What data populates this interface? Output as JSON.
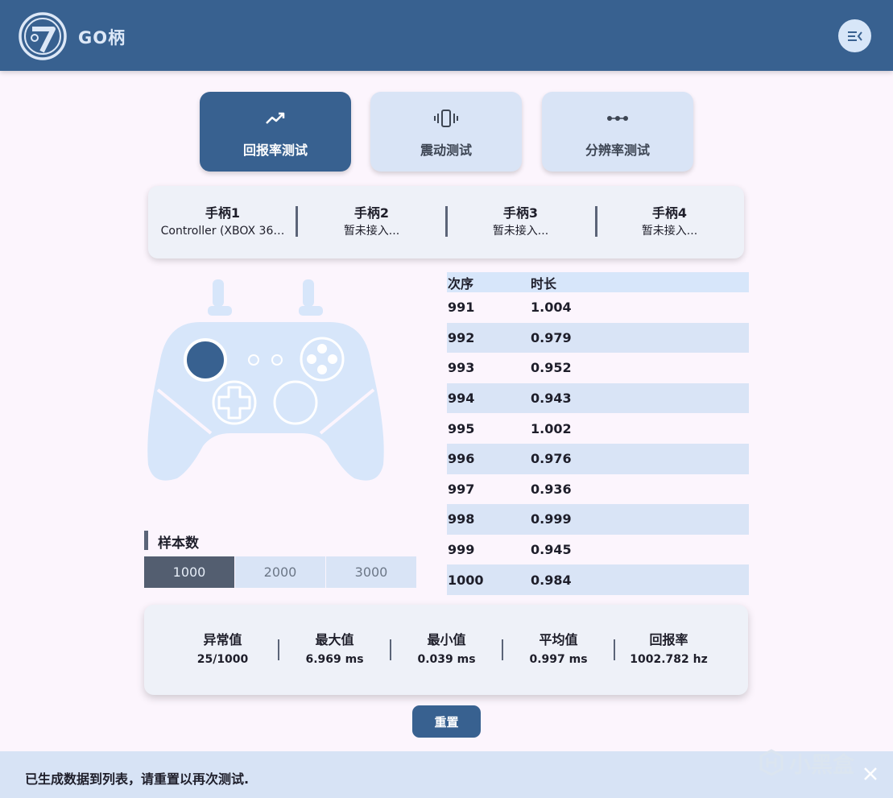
{
  "app": {
    "title": "GO柄",
    "logo_icon": "go-logo-icon",
    "menu_icon": "collapse-menu-icon"
  },
  "colors": {
    "primary": "#386190",
    "light": "#d9e4f6",
    "background": "#fcf5fd",
    "dark": "#535e70"
  },
  "tabs": [
    {
      "label": "回报率测试",
      "icon": "trend-up-icon",
      "active": true
    },
    {
      "label": "震动测试",
      "icon": "vibrate-icon",
      "active": false
    },
    {
      "label": "分辨率测试",
      "icon": "dots-icon",
      "active": false
    }
  ],
  "slots": [
    {
      "name": "手柄1",
      "status": "Controller (XBOX 36…"
    },
    {
      "name": "手柄2",
      "status": "暂未接入..."
    },
    {
      "name": "手柄3",
      "status": "暂未接入..."
    },
    {
      "name": "手柄4",
      "status": "暂未接入..."
    }
  ],
  "sample": {
    "title": "样本数",
    "options": [
      "1000",
      "2000",
      "3000"
    ],
    "selected": "1000"
  },
  "table": {
    "headers": [
      "次序",
      "时长"
    ],
    "rows": [
      [
        "991",
        "1.004"
      ],
      [
        "992",
        "0.979"
      ],
      [
        "993",
        "0.952"
      ],
      [
        "994",
        "0.943"
      ],
      [
        "995",
        "1.002"
      ],
      [
        "996",
        "0.976"
      ],
      [
        "997",
        "0.936"
      ],
      [
        "998",
        "0.999"
      ],
      [
        "999",
        "0.945"
      ],
      [
        "1000",
        "0.984"
      ]
    ]
  },
  "stats": [
    {
      "label": "异常值",
      "value": "25/1000"
    },
    {
      "label": "最大值",
      "value": "6.969 ms"
    },
    {
      "label": "最小值",
      "value": "0.039 ms"
    },
    {
      "label": "平均值",
      "value": "0.997 ms"
    },
    {
      "label": "回报率",
      "value": "1002.782 hz"
    }
  ],
  "reset_label": "重置",
  "status_message": "已生成数据到列表，请重置以再次测试.",
  "watermark": "小黑盒"
}
